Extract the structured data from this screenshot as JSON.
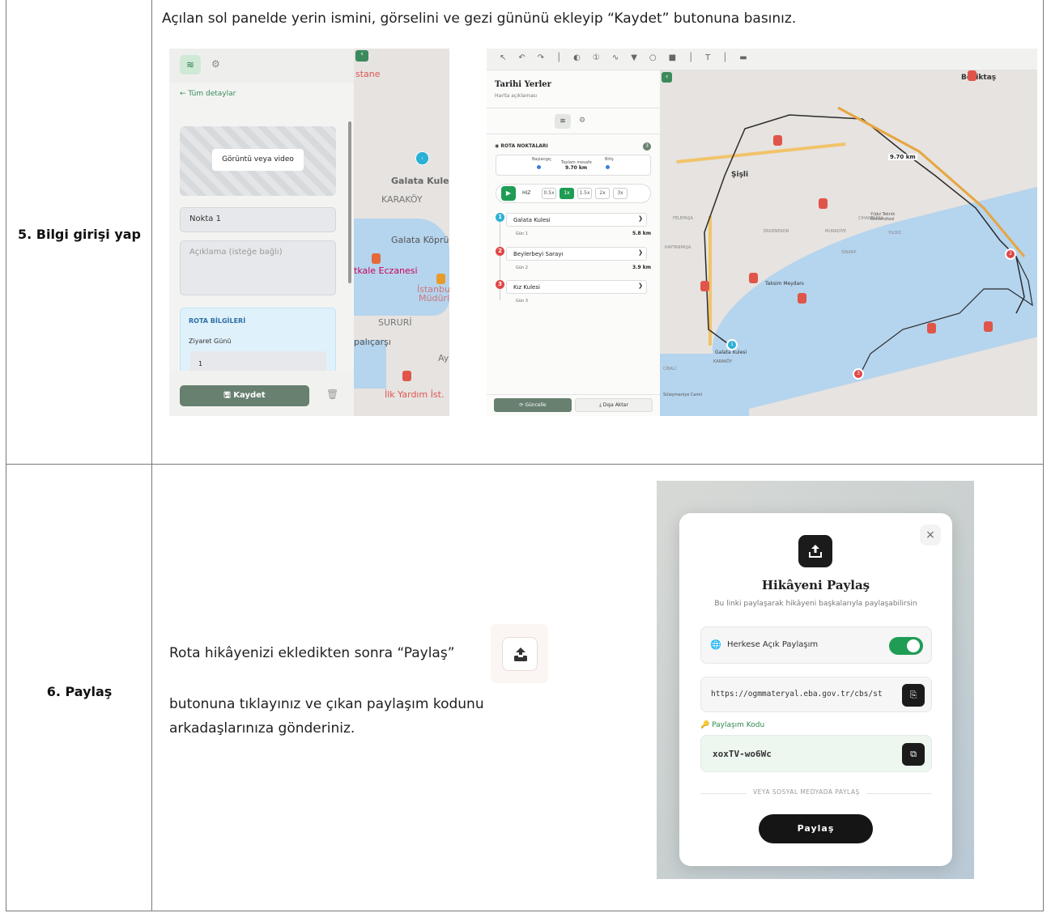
{
  "rows": [
    {
      "step": "5. Bilgi girişi yap",
      "instruction": "Açılan sol panelde yerin ismini, görselini ve gezi gününü ekleyip “Kaydet” butonuna basınız."
    },
    {
      "step": "6. Paylaş",
      "instruction_part1": "Rota hikâyenizi ekledikten sonra “Paylaş”",
      "instruction_part2": "butonuna tıklayınız ve çıkan paylaşım kodunu",
      "instruction_part3": "arkadaşlarınıza gönderiniz."
    }
  ],
  "left_panel": {
    "back_link": "← Tüm detaylar",
    "media_button": "Görüntü veya video",
    "name_value": "Nokta 1",
    "description_placeholder": "Açıklama (isteğe bağlı)",
    "route_info_title": "ROTA BİLGİLERİ",
    "visit_day_label": "Ziyaret Günü",
    "visit_day_value": "1",
    "save_button": "Kaydet",
    "map_labels": [
      "stane",
      "Galata Kulesi",
      "KARAKÖY",
      "Galata Köprüsü",
      "Eczanesi",
      "tkale Eczanesi",
      "İstanbul İl",
      "Müdürlü",
      "SURURİ",
      "palıçarşı",
      "Ay",
      "İlk Yardım İst."
    ],
    "pin_number": "1"
  },
  "right_panel": {
    "title": "Tarihi Yerler",
    "subtitle": "Harita açıklaması",
    "section_title": "ROTA NOKTALARI",
    "section_count": "3",
    "start_label": "Başlangıç",
    "distance_label": "Toplam mesafe",
    "distance_value": "9.70 km",
    "end_label": "Bitiş",
    "speed_label": "HIZ",
    "speeds": [
      "0.5x",
      "1x",
      "1.5x",
      "2x",
      "3x"
    ],
    "points": [
      {
        "num": "1",
        "name": "Galata Kulesi",
        "day": "Gün 1",
        "dist": "5.8 km",
        "color": "#2bb0d6"
      },
      {
        "num": "2",
        "name": "Beylerbeyi Sarayı",
        "day": "Gün 2",
        "dist": "3.9 km",
        "color": "#e04646"
      },
      {
        "num": "3",
        "name": "Kız Kulesi",
        "day": "Gün 3",
        "dist": "",
        "color": "#e04646"
      }
    ],
    "update_button": "Güncelle",
    "export_button": "Dışa Aktar",
    "map_labels": [
      "Beşiktaş",
      "Şişli",
      "9.70 km",
      "Taksim Meydanı",
      "Galata Kulesi",
      "KARAKÖY",
      "ERGENEKON",
      "MURADİYE",
      "CİHANNÜMA",
      "YILDIZ",
      "SİNANP",
      "KAPTANPAŞA",
      "FELEPAŞA",
      "Yıldız Teknik Üniversitesi",
      "Süleymaniye Camii",
      "CİBALİ"
    ]
  },
  "share_modal": {
    "title": "Hikâyeni Paylaş",
    "subtitle": "Bu linki paylaşarak hikâyeni başkalarıyla paylaşabilirsin",
    "public_label": "Herkese Açık Paylaşım",
    "link_value": "https://ogmmateryal.eba.gov.tr/cbs/st",
    "code_label": "Paylaşım Kodu",
    "code_value": "xoxTV-wo6Wc",
    "or_social": "VEYA SOSYAL MEDYADA PAYLAŞ",
    "share_button": "Paylaş",
    "close": "×"
  },
  "colors": {
    "accent_green": "#67806f",
    "toggle_green": "#1f9d55",
    "modal_dark": "#111111"
  }
}
